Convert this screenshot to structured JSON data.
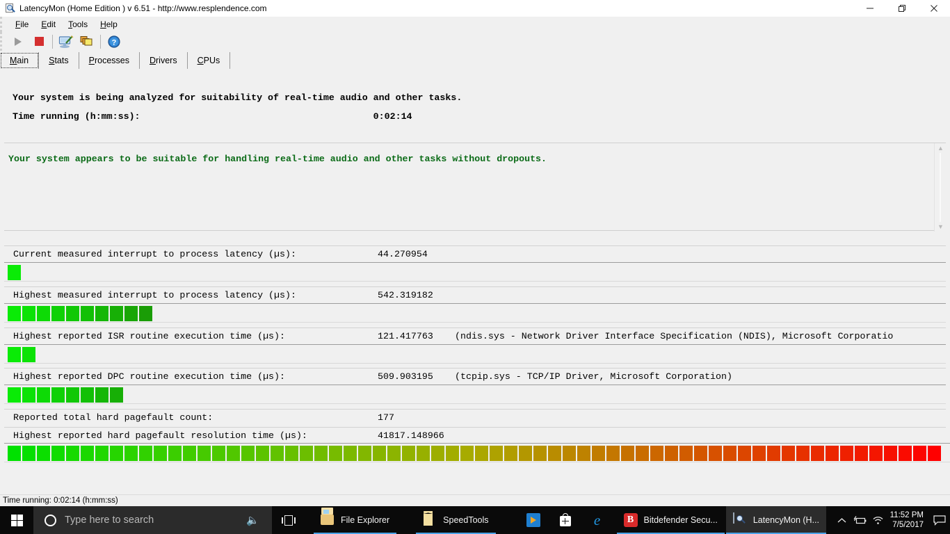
{
  "window": {
    "title": "LatencyMon  (Home Edition )  v 6.51 - http://www.resplendence.com",
    "app_icon": "latencymon-magnifier-icon",
    "minimize_label": "minimize-icon",
    "restore_label": "restore-icon",
    "close_label": "close-icon"
  },
  "menu": {
    "items": [
      {
        "label": "File"
      },
      {
        "label": "Edit"
      },
      {
        "label": "Tools"
      },
      {
        "label": "Help"
      }
    ]
  },
  "toolbar": {
    "buttons": [
      {
        "name": "start-button",
        "icon": "play-icon",
        "enabled": false
      },
      {
        "name": "stop-button",
        "icon": "stop-icon",
        "enabled": true
      },
      {
        "name": "report-button",
        "icon": "monitor-pen-icon",
        "enabled": true
      },
      {
        "name": "copy-button",
        "icon": "copy-windows-icon",
        "enabled": true
      },
      {
        "name": "help-button",
        "icon": "question-help-icon",
        "enabled": true
      }
    ]
  },
  "tabs": {
    "items": [
      {
        "label": "Main",
        "active": true
      },
      {
        "label": "Stats",
        "active": false
      },
      {
        "label": "Processes",
        "active": false
      },
      {
        "label": "Drivers",
        "active": false
      },
      {
        "label": "CPUs",
        "active": false
      }
    ]
  },
  "main": {
    "analysis_line": "Your system is being analyzed for suitability of real-time audio and other tasks.",
    "time_running_label": "Time running (h:mm:ss):",
    "time_running_value": "0:02:14",
    "verdict": "Your system appears to be suitable for handling real-time audio and other tasks without dropouts.",
    "verdict_color": "#0b6b17",
    "metrics": [
      {
        "label": "Current measured interrupt to process latency (µs):",
        "value": "44.270954",
        "extra": "",
        "bar_segments": 1,
        "bar_total": 64
      },
      {
        "label": "Highest measured interrupt to process latency (µs):",
        "value": "542.319182",
        "extra": "",
        "bar_segments": 10,
        "bar_total": 64
      },
      {
        "label": "Highest reported ISR routine execution time (µs):",
        "value": "121.417763",
        "extra": "(ndis.sys - Network Driver Interface Specification (NDIS), Microsoft Corporatio",
        "bar_segments": 2,
        "bar_total": 64
      },
      {
        "label": "Highest reported DPC routine execution time (µs):",
        "value": "509.903195",
        "extra": "(tcpip.sys - TCP/IP Driver, Microsoft Corporation)",
        "bar_segments": 8,
        "bar_total": 64
      }
    ],
    "pagefault_count_label": "Reported total hard pagefault count:",
    "pagefault_count_value": "177",
    "pagefault_time_label": "Highest reported hard pagefault resolution time (µs):",
    "pagefault_time_value": "41817.148966",
    "pagefault_bar_segments": 64,
    "pagefault_bar_full": true,
    "bar_color_start": "#00e600",
    "bar_color_end": "#ff0000"
  },
  "statusbar": {
    "text": "Time running: 0:02:14  (h:mm:ss)"
  },
  "taskbar": {
    "start_icon": "windows-start-icon",
    "search_placeholder": "Type here to search",
    "cortana_icon": "cortana-circle-icon",
    "mic_icon": "microphone-icon",
    "taskview_icon": "task-view-icon",
    "buttons": [
      {
        "label": "File Explorer",
        "icon": "folder-explorer-icon",
        "running": true,
        "active": false
      },
      {
        "label": "SpeedTools",
        "icon": "folder-icon",
        "running": true,
        "active": false
      },
      {
        "label": "",
        "icon": "media-player-icon",
        "running": false,
        "active": false
      },
      {
        "label": "",
        "icon": "microsoft-store-icon",
        "running": false,
        "active": false
      },
      {
        "label": "",
        "icon": "edge-browser-icon",
        "running": false,
        "active": false
      },
      {
        "label": "Bitdefender Secu...",
        "icon": "bitdefender-icon",
        "running": true,
        "active": false
      },
      {
        "label": "LatencyMon  (H...",
        "icon": "latencymon-icon",
        "running": true,
        "active": true
      }
    ],
    "tray": {
      "chevron_icon": "chevron-up-icon",
      "battery_icon": "battery-charging-icon",
      "network_icon": "wifi-icon",
      "time": "11:52 PM",
      "date": "7/5/2017",
      "action_center_icon": "action-center-icon"
    }
  }
}
